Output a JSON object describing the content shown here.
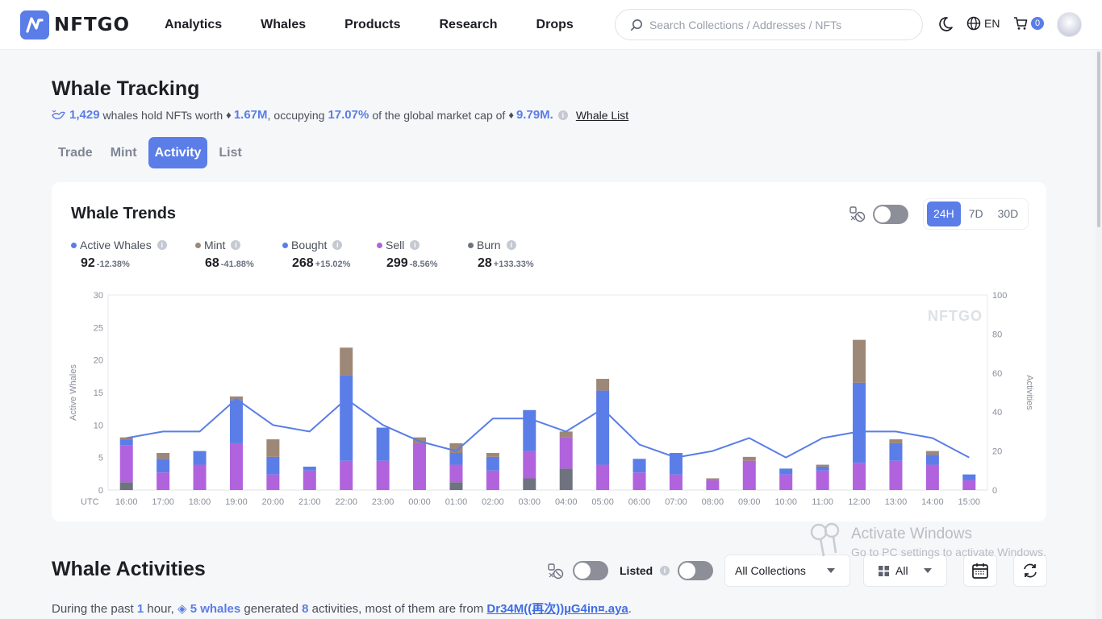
{
  "header": {
    "brand": "NFTGO",
    "nav": [
      "Analytics",
      "Whales",
      "Products",
      "Research",
      "Drops"
    ],
    "search_placeholder": "Search Collections / Addresses / NFTs",
    "lang": "EN",
    "cart_count": "0"
  },
  "page": {
    "title": "Whale Tracking",
    "summary": {
      "whale_count": "1,429",
      "text1": "whales hold NFTs worth",
      "worth": "1.67M",
      "text2": "occupying",
      "percent": "17.07%",
      "text3": "of the global market cap of",
      "market_cap": "9.79M.",
      "link": "Whale List"
    },
    "tabs": [
      "Trade",
      "Mint",
      "Activity",
      "List"
    ],
    "active_tab": "Activity"
  },
  "trends": {
    "title": "Whale Trends",
    "periods": [
      "24H",
      "7D",
      "30D"
    ],
    "active_period": "24H",
    "legend": [
      {
        "name": "Active Whales",
        "value": "92",
        "change": "-12.38%",
        "color": "#5a7de8"
      },
      {
        "name": "Mint",
        "value": "68",
        "change": "-41.88%",
        "color": "#9d8777"
      },
      {
        "name": "Bought",
        "value": "268",
        "change": "+15.02%",
        "color": "#5a7de8"
      },
      {
        "name": "Sell",
        "value": "299",
        "change": "-8.56%",
        "color": "#b063dd"
      },
      {
        "name": "Burn",
        "value": "28",
        "change": "+133.33%",
        "color": "#6f7380"
      }
    ],
    "watermark": "NFTGO"
  },
  "chart_data": {
    "type": "bar",
    "x_prefix": "UTC",
    "categories": [
      "16:00",
      "17:00",
      "18:00",
      "19:00",
      "20:00",
      "21:00",
      "22:00",
      "23:00",
      "00:00",
      "01:00",
      "02:00",
      "03:00",
      "04:00",
      "05:00",
      "06:00",
      "07:00",
      "08:00",
      "09:00",
      "10:00",
      "11:00",
      "12:00",
      "13:00",
      "14:00",
      "15:00"
    ],
    "ylabel": "Active Whales",
    "y2label": "Activities",
    "ylim": [
      0,
      30
    ],
    "y2lim": [
      0,
      100
    ],
    "yticks": [
      0,
      5,
      10,
      15,
      20,
      25,
      30
    ],
    "y2ticks": [
      0,
      20,
      40,
      60,
      80,
      100
    ],
    "stack_order": [
      "Burn",
      "Sell",
      "Bought",
      "Mint"
    ],
    "series": [
      {
        "name": "Burn",
        "color": "#6f7380",
        "axis": "right",
        "values": [
          4,
          0,
          0,
          0,
          0,
          0,
          0,
          0,
          0,
          4,
          0,
          6,
          11,
          0,
          0,
          0,
          0,
          0,
          0,
          0,
          0,
          0,
          0,
          0
        ]
      },
      {
        "name": "Sell",
        "color": "#b063dd",
        "axis": "right",
        "values": [
          19,
          9,
          13,
          24,
          8,
          10,
          15,
          15,
          24,
          9,
          10,
          14,
          16,
          13,
          9,
          8,
          5,
          15,
          8,
          10,
          14,
          15,
          13,
          5
        ]
      },
      {
        "name": "Bought",
        "color": "#5a7de8",
        "axis": "right",
        "values": [
          3,
          7,
          7,
          22,
          9,
          2,
          44,
          17,
          0,
          6,
          7,
          21,
          0,
          38,
          7,
          11,
          0,
          0,
          3,
          2,
          41,
          9,
          5,
          3
        ]
      },
      {
        "name": "Mint",
        "color": "#9d8777",
        "axis": "right",
        "values": [
          1,
          3,
          0,
          2,
          9,
          0,
          14,
          0,
          3,
          5,
          2,
          0,
          3,
          6,
          0,
          0,
          1,
          2,
          0,
          1,
          22,
          2,
          2,
          0
        ]
      },
      {
        "name": "Active Whales",
        "color": "#5a7de8",
        "axis": "left",
        "type": "line",
        "values": [
          8,
          9,
          9,
          14,
          10,
          9,
          14,
          10,
          7.5,
          6,
          11,
          11,
          9,
          12.5,
          7,
          5,
          6,
          8,
          5,
          8,
          9,
          9,
          8,
          5
        ]
      }
    ]
  },
  "activities": {
    "title": "Whale Activities",
    "listed_label": "Listed",
    "collections_select": "All Collections",
    "type_select": "All",
    "summary": {
      "p1": "During the past",
      "hours": "1",
      "p2": "hour,",
      "whales": "5 whales",
      "p3": "generated",
      "count": "8",
      "p4": "activities, most of them are from",
      "link": "Dr34M((再次))µG4in¤.aya"
    }
  },
  "overlay": {
    "line1": "Activate Windows",
    "line2": "Go to PC settings to activate Windows."
  }
}
